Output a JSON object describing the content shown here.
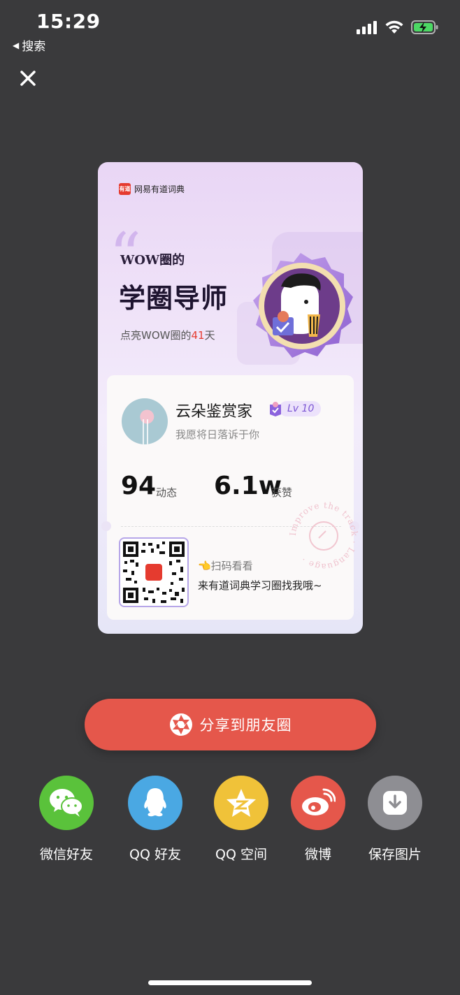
{
  "status_bar": {
    "time": "15:29",
    "back_label": "搜索"
  },
  "card": {
    "brand_name": "网易有道词典",
    "brand_logo_text": "有道",
    "quote_mark": "“",
    "subtitle": "WOW圈的",
    "title": "学圈导师",
    "days_prefix": "点亮WOW圈的",
    "days_count": "41",
    "days_suffix": "天",
    "user": {
      "name": "云朵鉴赏家",
      "level": "Lv 10",
      "motto": "我愿将日落诉于你"
    },
    "stats": [
      {
        "value": "94",
        "label": "动态"
      },
      {
        "value": "6.1w",
        "label": "获赞"
      }
    ],
    "scan_hint": "👈扫码看看",
    "scan_desc": "来有道词典学习圈找我哦~",
    "qr_logo_text": "有道",
    "stamp_text": "Improve the track · Language ·"
  },
  "share_button": {
    "label": "分享到朋友圈"
  },
  "share_targets": [
    {
      "label": "微信好友",
      "icon": "wechat-icon",
      "color": "#5ac23b"
    },
    {
      "label": "QQ 好友",
      "icon": "qq-icon",
      "color": "#4aa8e3"
    },
    {
      "label": "QQ 空间",
      "icon": "qzone-icon",
      "color": "#f0c239"
    },
    {
      "label": "微博",
      "icon": "weibo-icon",
      "color": "#e5574b"
    },
    {
      "label": "保存图片",
      "icon": "download-icon",
      "color": "#8e8e93"
    }
  ],
  "colors": {
    "background": "#3a3a3c",
    "accent": "#e5574b",
    "level": "#7b56d3"
  }
}
